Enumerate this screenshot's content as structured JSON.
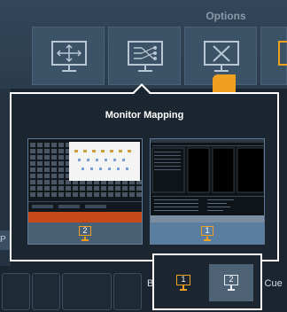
{
  "options": {
    "title": "Options",
    "buttons": [
      {
        "icon": "monitor-arrows-icon"
      },
      {
        "icon": "monitor-mapping-icon"
      },
      {
        "icon": "monitor-close-icon"
      },
      {
        "icon": "monitor-partial-icon"
      }
    ]
  },
  "dialog": {
    "title": "Monitor Mapping",
    "monitors": [
      {
        "label": "2",
        "icon": "monitor-icon"
      },
      {
        "label": "1",
        "icon": "monitor-icon"
      }
    ]
  },
  "picker": {
    "options": [
      {
        "label": "1",
        "icon": "monitor-icon",
        "selected": false
      },
      {
        "label": "2",
        "icon": "monitor-icon",
        "selected": true
      }
    ]
  },
  "background": {
    "left_tab": "P",
    "bottom_letter": "B",
    "cue_text": "s Cue"
  },
  "colors": {
    "accent": "#f0a020",
    "dialog_border": "#ffffff",
    "background": "#1b2530"
  }
}
